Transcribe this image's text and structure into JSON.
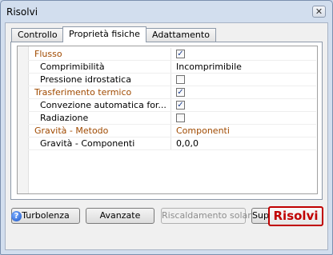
{
  "window": {
    "title": "Risolvi",
    "close_glyph": "✕"
  },
  "tabs": [
    {
      "label": "Controllo",
      "active": false
    },
    {
      "label": "Proprietà fisiche",
      "active": true
    },
    {
      "label": "Adattamento",
      "active": false
    }
  ],
  "properties": {
    "flusso": {
      "label": "Flusso",
      "checked": true
    },
    "comprimibilita": {
      "label": "Comprimibilità",
      "value": "Incomprimibile"
    },
    "pressione": {
      "label": "Pressione idrostatica",
      "checked": false
    },
    "trasferimento": {
      "label": "Trasferimento termico",
      "checked": true
    },
    "convezione": {
      "label": "Convezione automatica for...",
      "checked": true
    },
    "radiazione": {
      "label": "Radiazione",
      "checked": false
    },
    "gravita_metodo": {
      "label": "Gravità - Metodo",
      "value": "Componenti"
    },
    "gravita_componenti": {
      "label": "Gravità - Componenti",
      "value": "0,0,0"
    }
  },
  "buttons": {
    "turbolenza": "Turbolenza",
    "avanzate": "Avanzate",
    "riscaldamento": "Riscaldamento solare",
    "superficie": "Superficie libera",
    "risolvi": "Risolvi"
  },
  "icons": {
    "help": "help-icon",
    "close": "close-icon",
    "check": "✓"
  },
  "colors": {
    "category_text": "#a04a00",
    "risolvi_accent": "#c00000",
    "title_bar": "#d2deee"
  }
}
